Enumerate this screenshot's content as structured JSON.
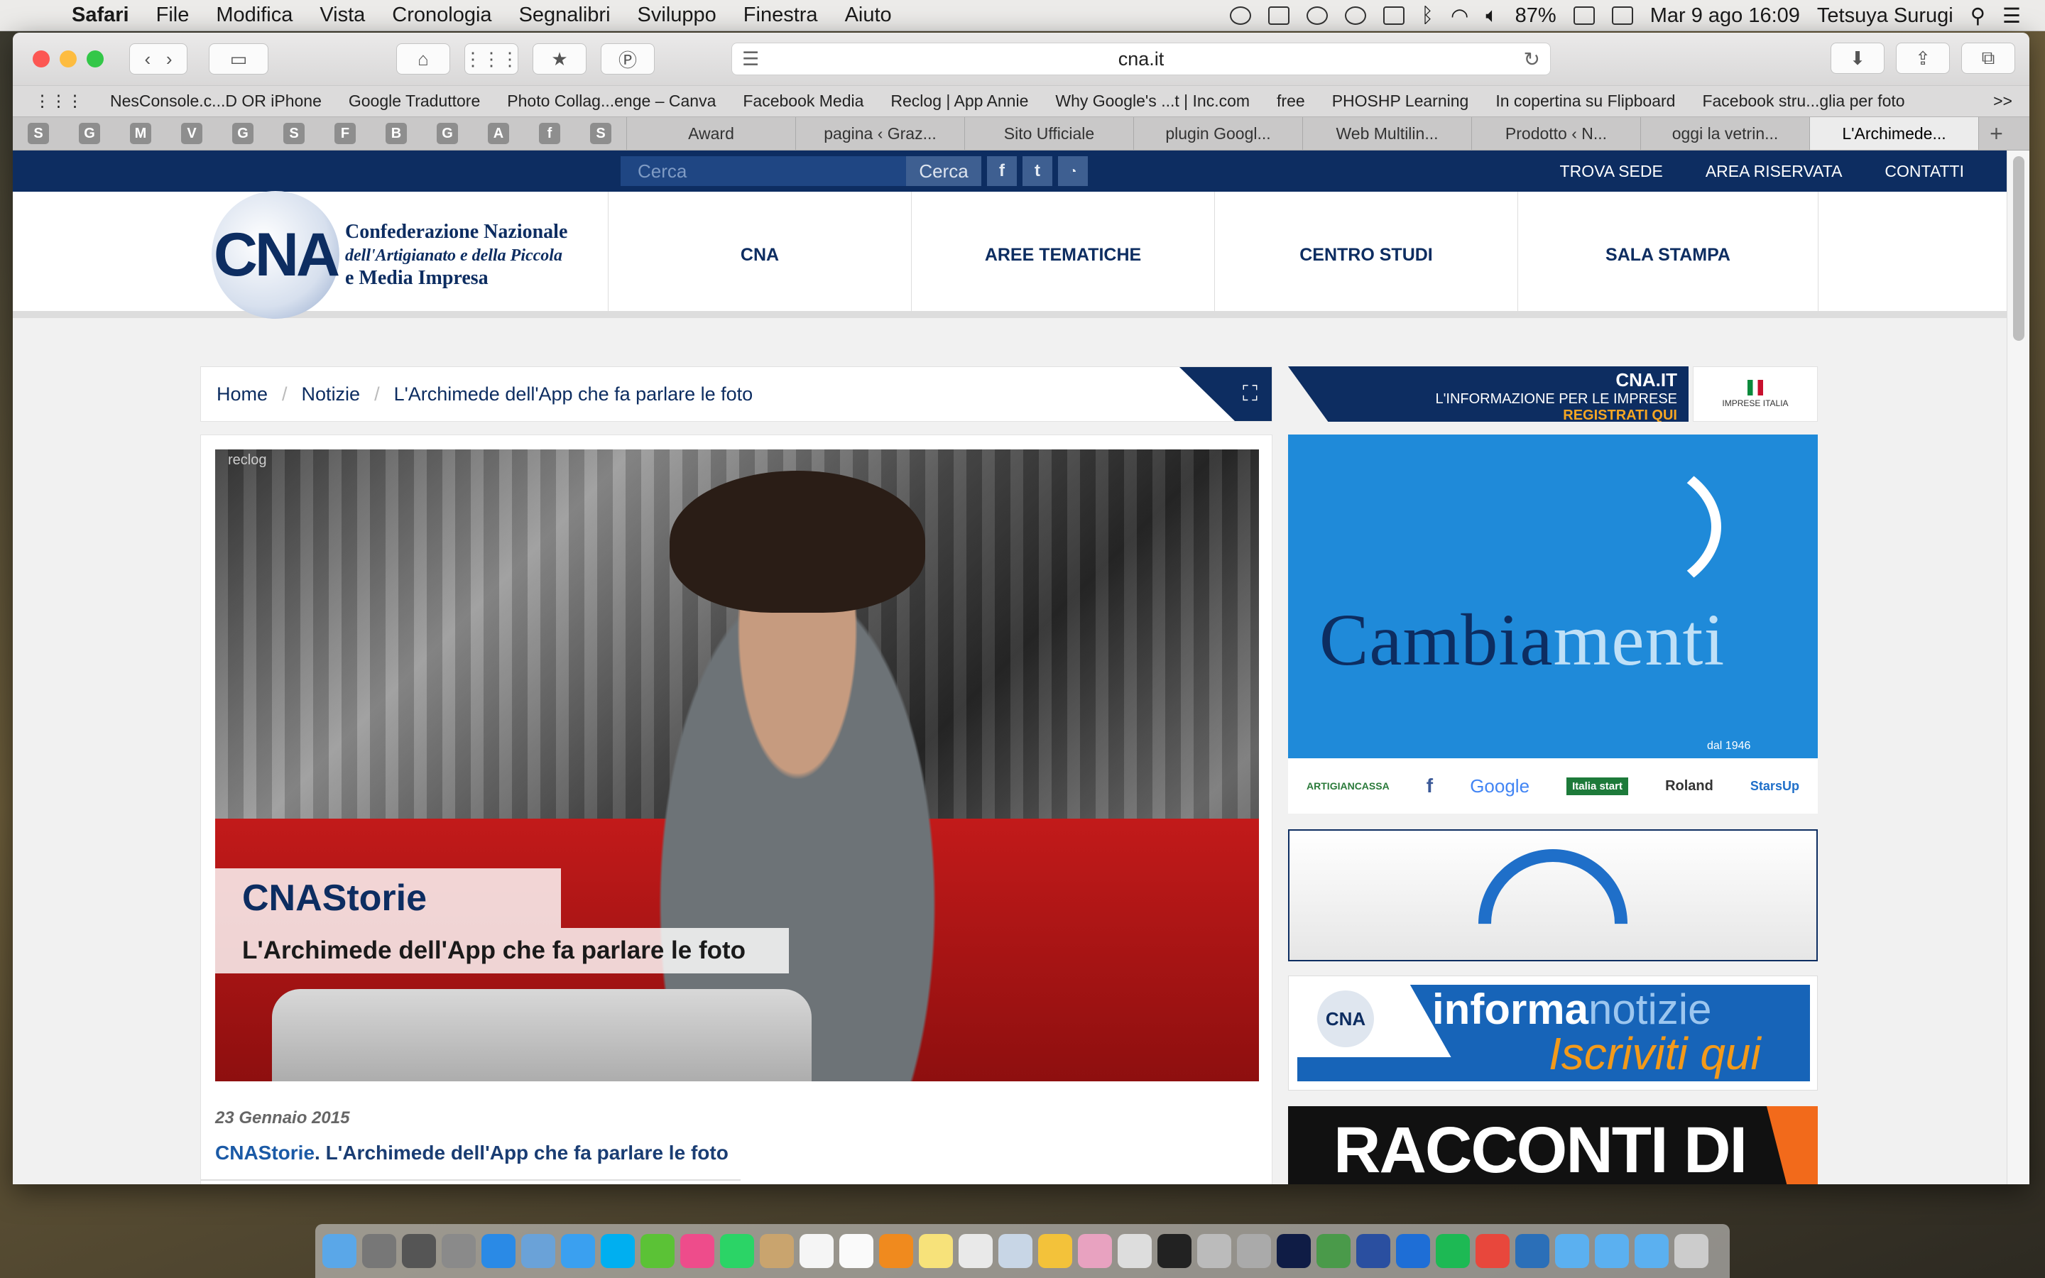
{
  "menubar": {
    "app": "Safari",
    "items": [
      "File",
      "Modifica",
      "Vista",
      "Cronologia",
      "Segnalibri",
      "Sviluppo",
      "Finestra",
      "Aiuto"
    ],
    "battery": "87%",
    "datetime": "Mar 9 ago  16:09",
    "user": "Tetsuya Surugi"
  },
  "browser": {
    "url": "cna.it",
    "favorites": [
      "NesConsole.c...D OR iPhone",
      "Google Traduttore",
      "Photo Collag...enge – Canva",
      "Facebook Media",
      "Reclog | App Annie",
      "Why Google's ...t | Inc.com",
      "free",
      "PHOSHP Learning",
      "In copertina su Flipboard",
      "Facebook stru...glia per foto"
    ],
    "overflow": ">>",
    "pinned_tabs": [
      "S",
      "G",
      "M",
      "V",
      "G",
      "S",
      "F",
      "B",
      "G",
      "A",
      "f",
      "S"
    ],
    "tabs": [
      "Award",
      "pagina ‹ Graz...",
      "Sito Ufficiale",
      "plugin Googl...",
      "Web Multilin...",
      "Prodotto ‹ N...",
      "oggi la vetrin...",
      "L'Archimede..."
    ],
    "new_tab": "+"
  },
  "site": {
    "search_placeholder": "Cerca",
    "search_button": "Cerca",
    "social": [
      "f",
      "t",
      "rss"
    ],
    "top_links": [
      "TROVA SEDE",
      "AREA RISERVATA",
      "CONTATTI"
    ],
    "logo_mark": "CNA",
    "logo_text": [
      "Confederazione Nazionale",
      "dell'Artigianato e della Piccola",
      "e Media Impresa"
    ],
    "nav": [
      "CNA",
      "AREE TEMATICHE",
      "CENTRO STUDI",
      "SALA STAMPA"
    ]
  },
  "breadcrumb": [
    "Home",
    "Notizie",
    "L'Archimede dell'App che fa parlare le foto"
  ],
  "article": {
    "watermark": "reclog",
    "caption_title": "CNAStorie",
    "caption_subtitle": "L'Archimede dell'App che fa parlare le foto",
    "date": "23 Gennaio 2015",
    "title_prefix": "CNAStorie",
    "title_rest": ". L'Archimede dell'App che fa parlare le foto"
  },
  "sidebar": {
    "cnait_title": "CNA.IT",
    "cnait_sub": "L'INFORMAZIONE PER LE IMPRESE",
    "cnait_cta": "REGISTRATI QUI",
    "rete_label": "IMPRESE ITALIA",
    "banner1_word_a": "Cambia",
    "banner1_word_b": "menti",
    "banner1_since": "dal 1946",
    "banner1_logos": [
      "ARTIGIANCASSA",
      "f",
      "Google",
      "Italia start",
      "Roland",
      "StarsUp"
    ],
    "banner3_a": "informa",
    "banner3_b": "notizie",
    "banner3_c": "Iscriviti qui",
    "banner3_logo": "CNA",
    "banner4": "RACCONTI DI"
  },
  "colors": {
    "brand": "#0d2d61",
    "accent": "#1f8ad9",
    "orange": "#f39a1a"
  }
}
